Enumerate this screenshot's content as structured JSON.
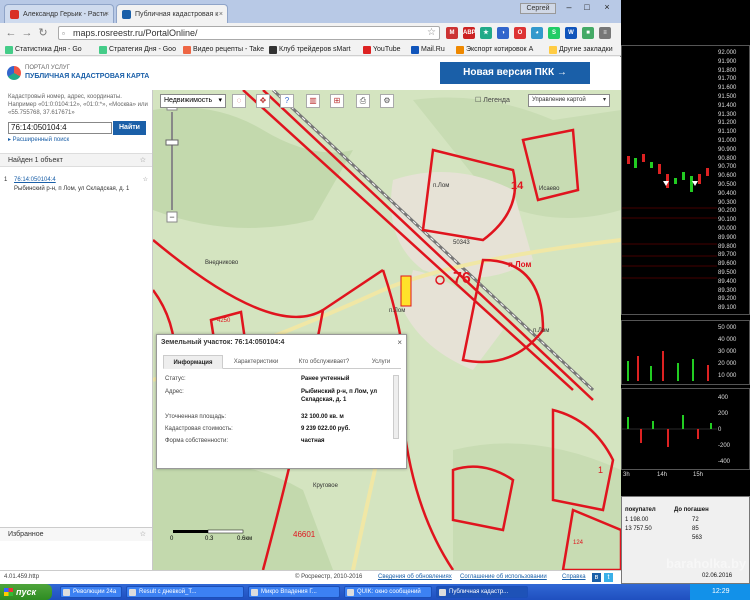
{
  "browser": {
    "tabs": [
      {
        "label": "Александр Герьик - Расти",
        "color": "#d93025"
      },
      {
        "label": "Публичная кадастровая к",
        "color": "#1a5fa8"
      }
    ],
    "profile": "Сергей",
    "url": "maps.rosreestr.ru/PortalOnline/",
    "extensions": [
      {
        "label": "M",
        "color": "#c33"
      },
      {
        "label": "ABP",
        "color": "#c22"
      },
      {
        "label": "★",
        "color": "#2a8"
      },
      {
        "label": "◑",
        "color": "#36c"
      },
      {
        "label": "O",
        "color": "#d33"
      },
      {
        "label": "◕",
        "color": "#39c"
      },
      {
        "label": "S",
        "color": "#2c6"
      },
      {
        "label": "W",
        "color": "#15b"
      },
      {
        "label": "■",
        "color": "#4a6"
      },
      {
        "label": "≡",
        "color": "#777"
      }
    ],
    "bookmarks": [
      {
        "label": "Статистика Дня - Go",
        "color": "#4c8"
      },
      {
        "label": "Стратегия Дня - Goo",
        "color": "#4c8"
      },
      {
        "label": "Видео рецепты - Take",
        "color": "#e64"
      },
      {
        "label": "Клуб трейдеров sMart",
        "color": "#333"
      },
      {
        "label": "YouTube",
        "color": "#d22"
      },
      {
        "label": "Mail.Ru",
        "color": "#15b"
      },
      {
        "label": "Экспорт котировок А",
        "color": "#e80"
      },
      {
        "label": "Другие закладки",
        "color": "#fc4"
      }
    ]
  },
  "header": {
    "logo_top": "ПОРТАЛ УСЛУГ",
    "logo_main": "ПУБЛИЧНАЯ КАДАСТРОВАЯ КАРТА",
    "new_version": "Новая версия ПКК →"
  },
  "left": {
    "help_text": "Кадастровый номер, адрес, координаты. Например «01:0:0104:12», «01:0:*», «Москва» или «55.755768, 37.617671»",
    "search_value": "76:14:050104:4",
    "find_button": "Найти",
    "advanced_link": "▸ Расширенный поиск",
    "found_title": "Найден 1 объект",
    "result_num": "1",
    "result_link": "76:14:050104:4",
    "result_address": "Рыбинский р-н, п Лом, ул Складская, д. 1",
    "favorites": "Избранное"
  },
  "map": {
    "layer_select": "Недвижимость",
    "legend_label": "Легенда",
    "map_control": "Управление картой",
    "labels": [
      {
        "text": "п.Лом"
      },
      {
        "text": "14"
      },
      {
        "text": "Исаево"
      },
      {
        "text": "50343"
      },
      {
        "text": "п.Лом"
      },
      {
        "text": "76"
      },
      {
        "text": "п.Лом"
      },
      {
        "text": "п.Лом"
      },
      {
        "text": "Внедниково"
      },
      {
        "text": "4250"
      },
      {
        "text": "1"
      },
      {
        "text": "46601"
      },
      {
        "text": "Круговое"
      },
      {
        "text": "124"
      }
    ],
    "scale": [
      "0",
      "0.3",
      "0.6км"
    ]
  },
  "popup": {
    "title": "Земельный участок: 76:14:050104:4",
    "tabs": [
      "Информация",
      "Характеристики",
      "Кто обслуживает?",
      "Услуги"
    ],
    "rows": [
      {
        "label": "Статус:",
        "value": "Ранее учтенный"
      },
      {
        "label": "Адрес:",
        "value": "Рыбинский р-н, п Лом, ул Складская, д. 1"
      },
      {
        "label": "Уточненная площадь:",
        "value": "32 100.00 кв. м"
      },
      {
        "label": "Кадастровая стоимость:",
        "value": "9 239 022.00 руб."
      },
      {
        "label": "Форма собственности:",
        "value": "частная"
      }
    ]
  },
  "statusbar": {
    "version": "4.01.459.http",
    "copyright": "© Росреестр, 2010-2016",
    "links": [
      "Сведения об обновлениях",
      "Соглашение об использовании",
      "Справка"
    ]
  },
  "terminal": {
    "price_scale": [
      "92.000",
      "91.900",
      "91.800",
      "91.700",
      "91.600",
      "91.500",
      "91.400",
      "91.300",
      "91.200",
      "91.100",
      "91.000",
      "90.900",
      "90.800",
      "90.700",
      "90.600",
      "90.500",
      "90.400",
      "90.300",
      "90.200",
      "90.100",
      "90.000",
      "89.900",
      "89.800",
      "89.700",
      "89.600",
      "89.500",
      "89.400",
      "89.300",
      "89.200",
      "89.100"
    ],
    "volume_scale": [
      "50 000",
      "40 000",
      "30 000",
      "20 000",
      "10 000"
    ],
    "osc_scale": [
      "400",
      "200",
      "0",
      "-200",
      "-400"
    ],
    "time_labels": [
      "3h",
      "14h",
      "15h"
    ],
    "table_headers": [
      "покупател",
      "До погашен"
    ],
    "table_rows": [
      {
        "a": "1 198.00",
        "b": "72"
      },
      {
        "a": "13 757.50",
        "b": "85"
      },
      {
        "a": "",
        "b": "563"
      }
    ],
    "date": "02.06.2016",
    "watermark": "baraholka.by"
  },
  "taskbar": {
    "start": "пуск",
    "tasks": [
      "Революции 24a",
      "Result с дневкой_T...",
      "Микро Впадения Г...",
      "QUIK: окно сообщений",
      "Публичная кадастр..."
    ],
    "clock": "12:29"
  }
}
